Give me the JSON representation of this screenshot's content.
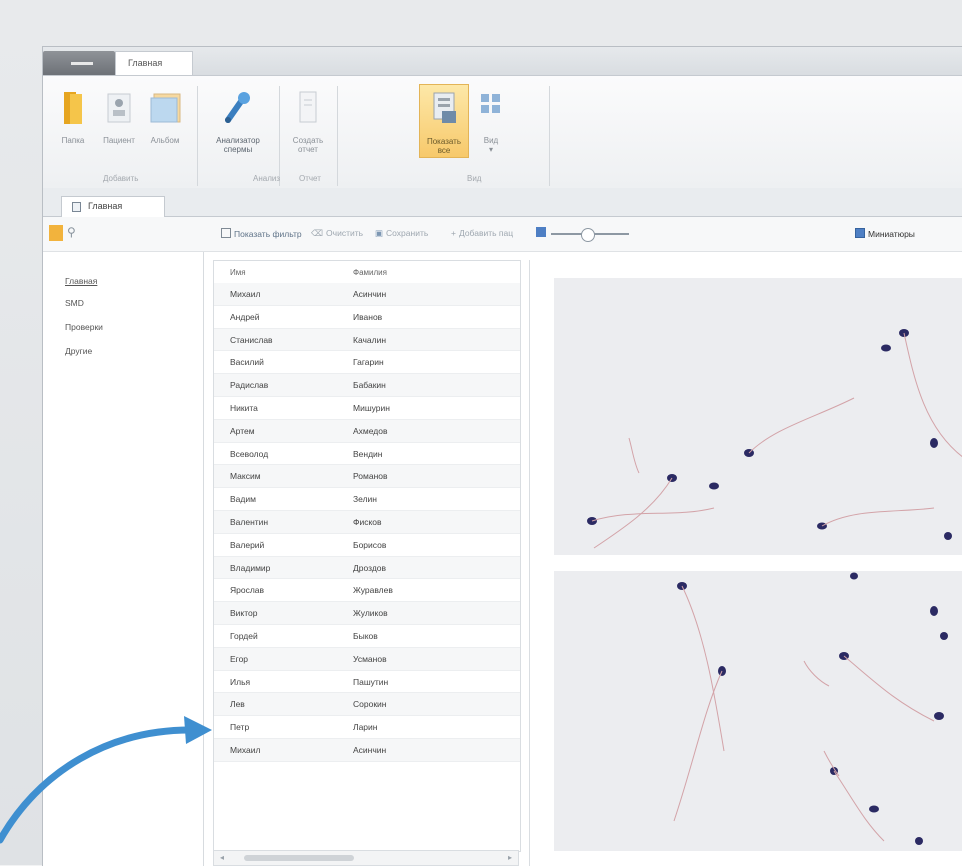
{
  "ribbon": {
    "home_tab": "Главная",
    "buttons": [
      {
        "label": "Папка",
        "icon": "folder-icon"
      },
      {
        "label": "Пациент",
        "icon": "patient-icon"
      },
      {
        "label": "Альбом",
        "icon": "album-icon"
      },
      {
        "label": "Анализатор спермы",
        "icon": "analyzer-icon"
      },
      {
        "label": "Создать отчет",
        "icon": "report-icon"
      },
      {
        "label": "Показать все",
        "icon": "show-all-icon"
      },
      {
        "label": "Вид",
        "icon": "view-icon"
      }
    ],
    "groups": [
      "Добавить",
      "Анализ",
      "Отчет",
      "Вид"
    ]
  },
  "doc_tab": "Главная",
  "toolbar": {
    "show_filter": "Показать фильтр",
    "clear": "Очистить",
    "save": "Сохранить",
    "add_tag": "Добавить пац",
    "thumbnails": "Миниатюры"
  },
  "sidebar": {
    "items": [
      "Главная",
      "SMD",
      "Проверки",
      "Другие"
    ]
  },
  "grid": {
    "columns": [
      "Имя",
      "Фамилия"
    ],
    "rows": [
      [
        "Михаил",
        "Асинчин"
      ],
      [
        "Андрей",
        "Иванов"
      ],
      [
        "Станислав",
        "Качалин"
      ],
      [
        "Василий",
        "Гагарин"
      ],
      [
        "Радислав",
        "Бабакин"
      ],
      [
        "Никита",
        "Мишурин"
      ],
      [
        "Артем",
        "Ахмедов"
      ],
      [
        "Всеволод",
        "Вендин"
      ],
      [
        "Максим",
        "Романов"
      ],
      [
        "Вадим",
        "Зелин"
      ],
      [
        "Валентин",
        "Фисков"
      ],
      [
        "Валерий",
        "Борисов"
      ],
      [
        "Владимир",
        "Дроздов"
      ],
      [
        "Ярослав",
        "Журавлев"
      ],
      [
        "Виктор",
        "Жуликов"
      ],
      [
        "Гордей",
        "Быков"
      ],
      [
        "Егор",
        "Усманов"
      ],
      [
        "Илья",
        "Пашутин"
      ],
      [
        "Лев",
        "Сорокин"
      ],
      [
        "Петр",
        "Ларин"
      ],
      [
        "Михаил",
        "Асинчин"
      ]
    ]
  },
  "colors": {
    "accent": "#f7c96b",
    "arrow": "#3f8fd0",
    "link": "#5f7388"
  }
}
